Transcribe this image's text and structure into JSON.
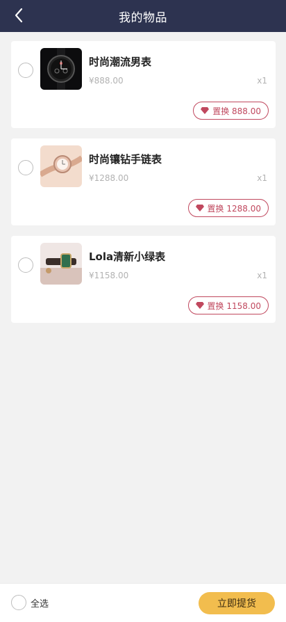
{
  "header": {
    "title": "我的物品",
    "back_icon": "chevron-left-icon"
  },
  "items": [
    {
      "name": "时尚潮流男表",
      "price": "¥888.00",
      "qty": "x1",
      "redeem_label": "置换 888.00"
    },
    {
      "name": "时尚镶钻手链表",
      "price": "¥1288.00",
      "qty": "x1",
      "redeem_label": "置换 1288.00"
    },
    {
      "name": "Lola清新小绿表",
      "price": "¥1158.00",
      "qty": "x1",
      "redeem_label": "置换 1158.00"
    }
  ],
  "footer": {
    "select_all_label": "全选",
    "pickup_label": "立即提货"
  },
  "colors": {
    "header_bg": "#2d3350",
    "accent_pink": "#c0485e",
    "button_yellow": "#f2bd4e"
  }
}
